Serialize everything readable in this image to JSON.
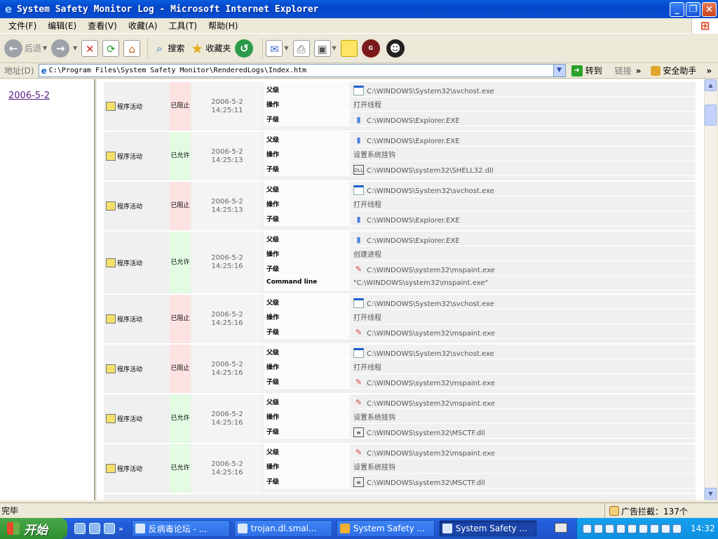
{
  "window": {
    "title": "System Safety Monitor Log - Microsoft Internet Explorer",
    "min": "_",
    "max": "❐",
    "close": "×"
  },
  "menu": [
    "文件(F)",
    "编辑(E)",
    "查看(V)",
    "收藏(A)",
    "工具(T)",
    "帮助(H)"
  ],
  "toolbar": {
    "back": "后退",
    "search": "搜索",
    "favorites": "收藏夹"
  },
  "address": {
    "label": "地址(D)",
    "url": "C:\\Program Files\\System Safety Monitor\\RenderedLogs\\Index.htm",
    "go": "转到",
    "links": "链接",
    "assistant": "安全助手"
  },
  "sidebar": {
    "date_link": "2006-5-2"
  },
  "log": {
    "rows": [
      {
        "action": "程序活动",
        "status": "已阻止",
        "status_kind": "blocked",
        "date": "2006-5-2",
        "time": "14:25:11",
        "details": [
          {
            "key": "父级",
            "value": "C:\\WINDOWS\\System32\\svchost.exe",
            "icon": "window-icon"
          },
          {
            "key": "操作",
            "value": "打开线程",
            "icon": ""
          },
          {
            "key": "子级",
            "value": "C:\\WINDOWS\\Explorer.EXE",
            "icon": "explorer-icon"
          }
        ]
      },
      {
        "action": "程序活动",
        "status": "已允许",
        "status_kind": "allowed",
        "date": "2006-5-2",
        "time": "14:25:13",
        "details": [
          {
            "key": "父级",
            "value": "C:\\WINDOWS\\Explorer.EXE",
            "icon": "explorer-icon"
          },
          {
            "key": "操作",
            "value": "设置系统挂钩",
            "icon": ""
          },
          {
            "key": "子级",
            "value": "C:\\WINDOWS\\system32\\SHELL32.dll",
            "icon": "dll-icon"
          }
        ]
      },
      {
        "action": "程序活动",
        "status": "已阻止",
        "status_kind": "blocked",
        "date": "2006-5-2",
        "time": "14:25:13",
        "details": [
          {
            "key": "父级",
            "value": "C:\\WINDOWS\\System32\\svchost.exe",
            "icon": "window-icon"
          },
          {
            "key": "操作",
            "value": "打开线程",
            "icon": ""
          },
          {
            "key": "子级",
            "value": "C:\\WINDOWS\\Explorer.EXE",
            "icon": "explorer-icon"
          }
        ]
      },
      {
        "action": "程序活动",
        "status": "已允许",
        "status_kind": "allowed",
        "date": "2006-5-2",
        "time": "14:25:16",
        "details": [
          {
            "key": "父级",
            "value": "C:\\WINDOWS\\Explorer.EXE",
            "icon": "explorer-icon"
          },
          {
            "key": "操作",
            "value": "创建进程",
            "icon": ""
          },
          {
            "key": "子级",
            "value": "C:\\WINDOWS\\system32\\mspaint.exe",
            "icon": "paint-icon"
          },
          {
            "key": "Command line",
            "value": "\"C:\\WINDOWS\\system32\\mspaint.exe\"",
            "icon": ""
          }
        ]
      },
      {
        "action": "程序活动",
        "status": "已阻止",
        "status_kind": "blocked",
        "date": "2006-5-2",
        "time": "14:25:16",
        "details": [
          {
            "key": "父级",
            "value": "C:\\WINDOWS\\System32\\svchost.exe",
            "icon": "window-icon"
          },
          {
            "key": "操作",
            "value": "打开线程",
            "icon": ""
          },
          {
            "key": "子级",
            "value": "C:\\WINDOWS\\system32\\mspaint.exe",
            "icon": "paint-icon"
          }
        ]
      },
      {
        "action": "程序活动",
        "status": "已阻止",
        "status_kind": "blocked",
        "date": "2006-5-2",
        "time": "14:25:16",
        "details": [
          {
            "key": "父级",
            "value": "C:\\WINDOWS\\System32\\svchost.exe",
            "icon": "window-icon"
          },
          {
            "key": "操作",
            "value": "打开线程",
            "icon": ""
          },
          {
            "key": "子级",
            "value": "C:\\WINDOWS\\system32\\mspaint.exe",
            "icon": "paint-icon"
          }
        ]
      },
      {
        "action": "程序活动",
        "status": "已允许",
        "status_kind": "allowed",
        "date": "2006-5-2",
        "time": "14:25:16",
        "details": [
          {
            "key": "父级",
            "value": "C:\\WINDOWS\\system32\\mspaint.exe",
            "icon": "paint-icon"
          },
          {
            "key": "操作",
            "value": "设置系统挂钩",
            "icon": ""
          },
          {
            "key": "子级",
            "value": "C:\\WINDOWS\\system32\\MSCTF.dll",
            "icon": "ctf-dll-icon"
          }
        ]
      },
      {
        "action": "程序活动",
        "status": "已允许",
        "status_kind": "allowed",
        "date": "2006-5-2",
        "time": "14:25:16",
        "details": [
          {
            "key": "父级",
            "value": "C:\\WINDOWS\\system32\\mspaint.exe",
            "icon": "paint-icon"
          },
          {
            "key": "操作",
            "value": "设置系统挂钩",
            "icon": ""
          },
          {
            "key": "子级",
            "value": "C:\\WINDOWS\\system32\\MSCTF.dll",
            "icon": "ctf-dll-icon"
          }
        ]
      }
    ]
  },
  "statusbar": {
    "status": "完毕",
    "popup_blocker": "广告拦截：137个"
  },
  "taskbar": {
    "start": "开始",
    "more": "»",
    "tasks": [
      {
        "label": "反病毒论坛 - ..."
      },
      {
        "label": "trojan.dl.smal..."
      },
      {
        "label": "System Safety ..."
      },
      {
        "label": "System Safety ..."
      }
    ],
    "clock": "14:32"
  }
}
